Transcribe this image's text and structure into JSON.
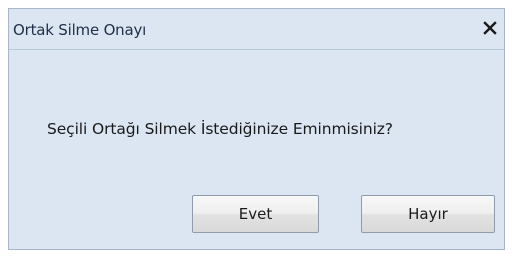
{
  "dialog": {
    "title": "Ortak Silme Onayı",
    "close_icon": "close-icon",
    "message": "Seçili Ortağı Silmek İstediğinize Eminmisiniz?",
    "buttons": {
      "yes_label": "Evet",
      "no_label": "Hayır"
    }
  }
}
